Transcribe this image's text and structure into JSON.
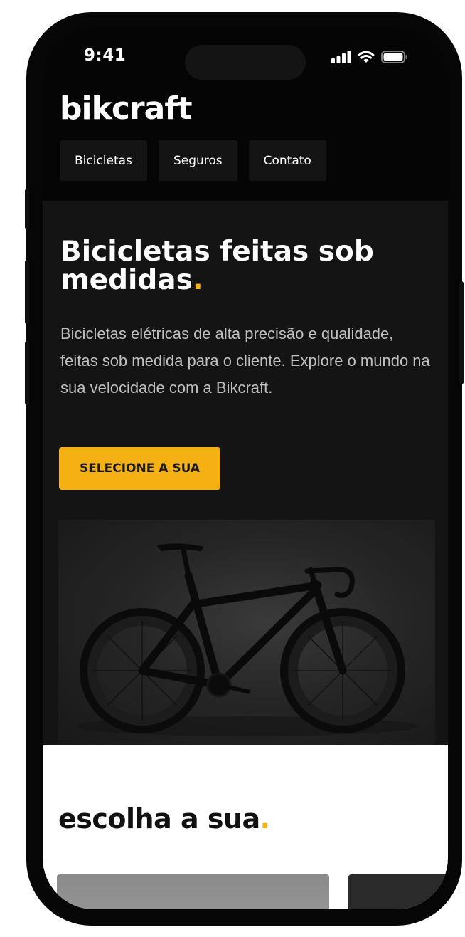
{
  "status_bar": {
    "time": "9:41"
  },
  "header": {
    "logo": "bikcraft",
    "nav": [
      "Bicicletas",
      "Seguros",
      "Contato"
    ]
  },
  "hero": {
    "title": "Bicicletas feitas sob medidas",
    "title_accent": ".",
    "description": "Bicicletas elétricas de alta precisão e qualidade, feitas sob medida para o cliente. Explore o mundo na sua velocidade com a Bikcraft.",
    "cta_label": "SELECIONE A SUA"
  },
  "products": {
    "title": "escolha a sua",
    "title_accent": "."
  },
  "colors": {
    "accent": "#f5b014",
    "dark": "#141414",
    "black": "#050505"
  },
  "icons": [
    "signal-icon",
    "wifi-icon",
    "battery-icon"
  ]
}
